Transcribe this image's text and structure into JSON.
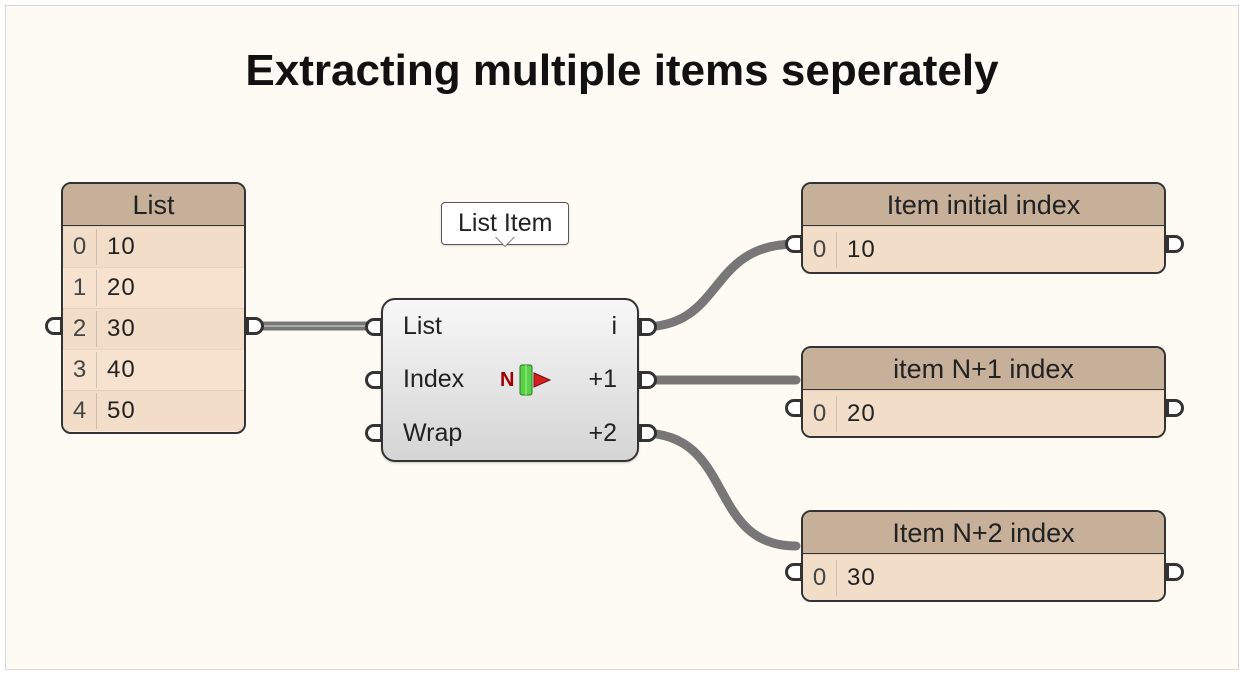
{
  "title": "Extracting multiple items seperately",
  "tooltip": "List Item",
  "source_panel": {
    "header": "List",
    "rows": [
      {
        "index": "0",
        "value": "10"
      },
      {
        "index": "1",
        "value": "20"
      },
      {
        "index": "2",
        "value": "30"
      },
      {
        "index": "3",
        "value": "40"
      },
      {
        "index": "4",
        "value": "50"
      }
    ]
  },
  "component": {
    "name": "List Item",
    "inputs": [
      "List",
      "Index",
      "Wrap"
    ],
    "outputs": [
      "i",
      "+1",
      "+2"
    ],
    "icon_label": "N"
  },
  "output_panels": [
    {
      "header": "Item initial index",
      "rows": [
        {
          "index": "0",
          "value": "10"
        }
      ]
    },
    {
      "header": "item N+1 index",
      "rows": [
        {
          "index": "0",
          "value": "20"
        }
      ]
    },
    {
      "header": "Item N+2 index",
      "rows": [
        {
          "index": "0",
          "value": "30"
        }
      ]
    }
  ]
}
